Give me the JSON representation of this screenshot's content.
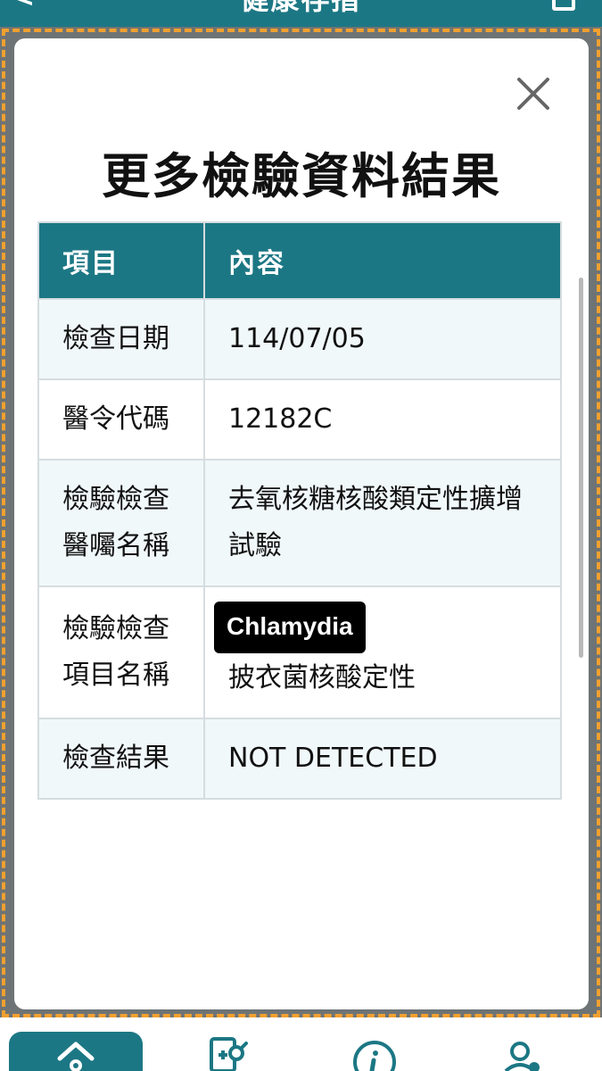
{
  "topbar": {
    "back_glyph": "<",
    "title": "健康存摺"
  },
  "modal": {
    "title": "更多檢驗資料結果",
    "close_glyph": "×",
    "table": {
      "headers": [
        "項目",
        "內容"
      ],
      "rows": [
        {
          "item": "檢查日期",
          "value": "114/07/05"
        },
        {
          "item": "醫令代碼",
          "value": "12182C"
        },
        {
          "item": "檢驗檢查醫囑名稱",
          "value": "去氧核糖核酸類定性擴增試驗"
        },
        {
          "item": "檢驗檢查項目名稱",
          "badge": "Chlamydia",
          "value": "披衣菌核酸定性"
        },
        {
          "item": "檢查結果",
          "value": "NOT DETECTED"
        }
      ]
    }
  },
  "colors": {
    "teal": "#1c7784",
    "focus_dash": "#f0a030",
    "row_alt": "#f1f8fa"
  },
  "bottom_nav": {
    "items": [
      {
        "icon": "home-icon",
        "active": true
      },
      {
        "icon": "medical-search-icon",
        "active": false
      },
      {
        "icon": "info-icon",
        "active": false
      },
      {
        "icon": "user-settings-icon",
        "active": false
      }
    ]
  }
}
